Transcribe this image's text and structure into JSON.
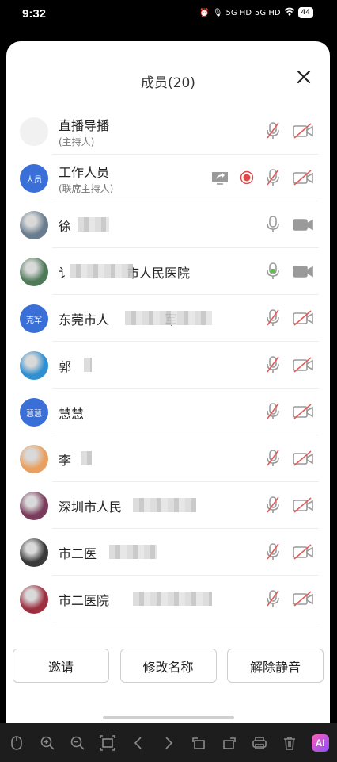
{
  "status": {
    "time": "9:32",
    "signal1": "5G HD",
    "signal2": "5G HD",
    "battery": "44"
  },
  "sheet": {
    "title": "成员(20)"
  },
  "members": [
    {
      "name": "直播导播",
      "sub": "(主持人)",
      "avatar_text": "",
      "avatar_style": "blank",
      "mic": "muted",
      "cam": "off"
    },
    {
      "name": "工作人员",
      "sub": "(联席主持人)",
      "avatar_text": "人员",
      "avatar_style": "blue",
      "mic": "muted",
      "cam": "off",
      "share": true,
      "record": true
    },
    {
      "name": "徐",
      "sub": "",
      "avatar_text": "",
      "avatar_style": "photo",
      "mic": "on",
      "cam": "on"
    },
    {
      "name": "讠",
      "name_suffix": "市人民医院",
      "sub": "",
      "avatar_text": "",
      "avatar_style": "photo",
      "mic": "active",
      "cam": "on"
    },
    {
      "name": "东莞市人",
      "name_suffix": "军",
      "sub": "",
      "avatar_text": "克军",
      "avatar_style": "blue",
      "mic": "muted",
      "cam": "off"
    },
    {
      "name": "郭",
      "sub": "",
      "avatar_text": "",
      "avatar_style": "photo",
      "mic": "muted",
      "cam": "off"
    },
    {
      "name": "慧慧",
      "sub": "",
      "avatar_text": "慧慧",
      "avatar_style": "blue",
      "mic": "muted",
      "cam": "off"
    },
    {
      "name": "李",
      "sub": "",
      "avatar_text": "",
      "avatar_style": "photo",
      "mic": "muted",
      "cam": "off"
    },
    {
      "name": "深圳市人民",
      "sub": "",
      "avatar_text": "",
      "avatar_style": "photo",
      "mic": "muted",
      "cam": "off"
    },
    {
      "name": "市二医",
      "sub": "",
      "avatar_text": "",
      "avatar_style": "photo",
      "mic": "muted",
      "cam": "off"
    },
    {
      "name": "市二医院",
      "sub": "",
      "avatar_text": "",
      "avatar_style": "photo",
      "mic": "muted",
      "cam": "off"
    }
  ],
  "footer": {
    "invite": "邀请",
    "rename": "修改名称",
    "unmute": "解除静音"
  },
  "toolbar": {
    "ai": "AI"
  }
}
